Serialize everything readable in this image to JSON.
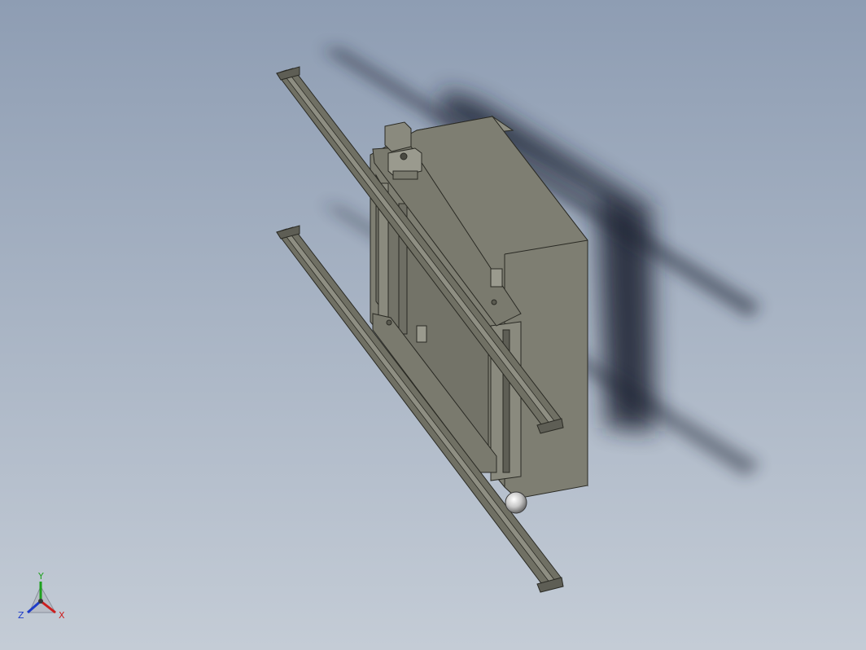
{
  "viewport": {
    "background_top": "#8e9db3",
    "background_bottom": "#c4ccd6"
  },
  "model": {
    "body_color": "#7e7e72",
    "rail_color": "#707064",
    "shadow_color": "#1e2430"
  },
  "triad": {
    "x_label": "X",
    "y_label": "Y",
    "z_label": "Z",
    "x_color": "#cc1e1e",
    "y_color": "#1ea01e",
    "z_color": "#1e3cc8"
  }
}
